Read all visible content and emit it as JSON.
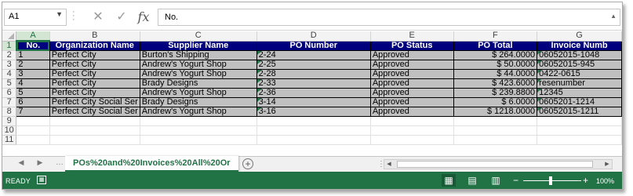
{
  "formula_bar": {
    "name_box": "A1",
    "formula": "No.",
    "cancel_icon": "x-icon",
    "enter_icon": "check-icon",
    "fx_label": "fx"
  },
  "columns": [
    "A",
    "B",
    "C",
    "D",
    "E",
    "F",
    "G"
  ],
  "active_column": "A",
  "active_row": "1",
  "row_numbers": [
    "1",
    "2",
    "3",
    "4",
    "5",
    "6",
    "7",
    "8",
    "9",
    "10",
    "11"
  ],
  "table": {
    "headers": [
      "No.",
      "Organization Name",
      "Supplier Name",
      "PO Number",
      "PO Status",
      "PO Total",
      "Invoice Numb"
    ],
    "rows": [
      [
        "1",
        "Perfect City",
        "Burton's Shipping",
        "2-24",
        "Approved",
        "$ 264.0000",
        "06052015-1048"
      ],
      [
        "2",
        "Perfect City",
        "Andrew's Yogurt Shop",
        "2-25",
        "Approved",
        "$ 50.0000",
        "06052015-945"
      ],
      [
        "3",
        "Perfect City",
        "Andrew's Yogurt Shop",
        "2-28",
        "Approved",
        "$ 44.0000",
        "0422-0615"
      ],
      [
        "4",
        "Perfect City",
        "Brady Designs",
        "2-33",
        "Approved",
        "$ 423.6000",
        "resenumber"
      ],
      [
        "5",
        "Perfect City",
        "Andrew's Yogurt Shop",
        "2-36",
        "Approved",
        "$ 239.8800",
        "12345"
      ],
      [
        "6",
        "Perfect City Social Ser",
        "Brady Designs",
        "3-14",
        "Approved",
        "$ 6.0000",
        "0605201-1214"
      ],
      [
        "7",
        "Perfect City Social Ser",
        "Andrew's Yogurt Shop",
        "3-16",
        "Approved",
        "$ 1218.0000",
        "06052015-1211"
      ]
    ]
  },
  "sheet_tabs": {
    "active": "POs%20and%20Invoices%20All%20Or",
    "add_label": "+"
  },
  "status_bar": {
    "mode": "READY",
    "zoom": "100%"
  },
  "colors": {
    "header_bg": "#00007f",
    "data_bg": "#c0c0c0",
    "excel_green": "#217346"
  }
}
